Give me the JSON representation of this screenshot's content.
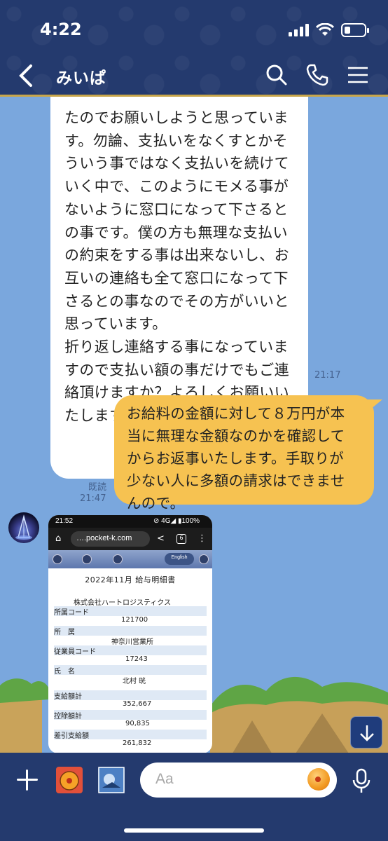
{
  "status_bar": {
    "time": "4:22"
  },
  "header": {
    "title": "みいぱ"
  },
  "messages": {
    "incoming_text": "たのでお願いしようと思っていま\nす。勿論、支払いをなくすとかそ\nういう事ではなく支払いを続けて\nいく中で、このようにモメる事が\nないように窓口になって下さると\nの事です。僕の方も無理な支払い\nの約束をする事は出来ないし、お\n互いの連絡も全て窓口になって下\nさるとの事なのでその方がいいと\n思っています。\n折り返し連絡する事になっていま\nすので支払い額の事だけでもご連\n絡頂けますか？よろしくお願いい\nたします。",
    "incoming_time": "21:17",
    "outgoing_text": "お給料の金額に対して８万円が本\n当に無理な金額なのかを確認して\nからお返事いたします。手取りが\n少ない人に多額の請求はできませ\nんので。",
    "outgoing_read": "既読",
    "outgoing_time": "21:47"
  },
  "screenshot": {
    "status_time": "21:52",
    "status_right": "⊘ 4G◢ ▮100%",
    "url": "….pocket-k.com",
    "english_btn": "English",
    "doc_title": "2022年11月 給与明細書",
    "company": "株式会社ハートロジスティクス",
    "dept_code_label": "所属コード",
    "dept_code": "121700",
    "dept_label": "所　属",
    "dept": "神奈川営業所",
    "emp_code_label": "従業員コード",
    "emp_code": "17243",
    "name_label": "氏　名",
    "name": "北村 晄",
    "total_pay_label": "支給額計",
    "total_pay": "352,667",
    "deduction_label": "控除額計",
    "deduction": "90,835",
    "net_label": "差引支給額",
    "net": "261,832"
  },
  "input": {
    "placeholder": "Aa"
  }
}
